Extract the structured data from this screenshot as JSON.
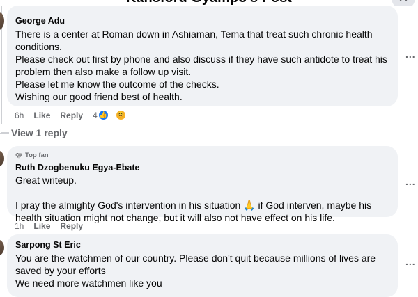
{
  "header": {
    "title": "Kansford Gyampo's Post",
    "close_icon": "close-icon"
  },
  "comments": [
    {
      "author": "George Adu",
      "lines": [
        "There is a center at Roman down in Ashiaman, Tema that treat such chronic health",
        "conditions.",
        "Please check out first by phone and also discuss if they have such antidote to treat his",
        "problem then also make a follow up visit.",
        "Please let me know the outcome of the checks.",
        "Wishing our good friend best of health."
      ],
      "time": "6h",
      "like_label": "Like",
      "reply_label": "Reply",
      "reaction_count": "4",
      "reactions": [
        "like-icon",
        "haha-icon"
      ]
    },
    {
      "badge": "Top fan",
      "author": "Ruth Dzogbenuku Egya-Ebate",
      "lines": [
        "Great writeup.",
        "",
        "I pray the almighty God's intervention in his situation 🙏 if God interven, maybe his",
        "health situation might not change, but it will also not have effect on his life."
      ],
      "time": "1h",
      "like_label": "Like",
      "reply_label": "Reply"
    },
    {
      "author": "Sarpong St Eric",
      "lines": [
        "You are the watchmen of our country. Please don't quit because millions of lives are",
        "saved by your efforts",
        "We need more watchmen like you"
      ]
    }
  ],
  "view_reply_label": "View 1 reply",
  "more_label": "..."
}
